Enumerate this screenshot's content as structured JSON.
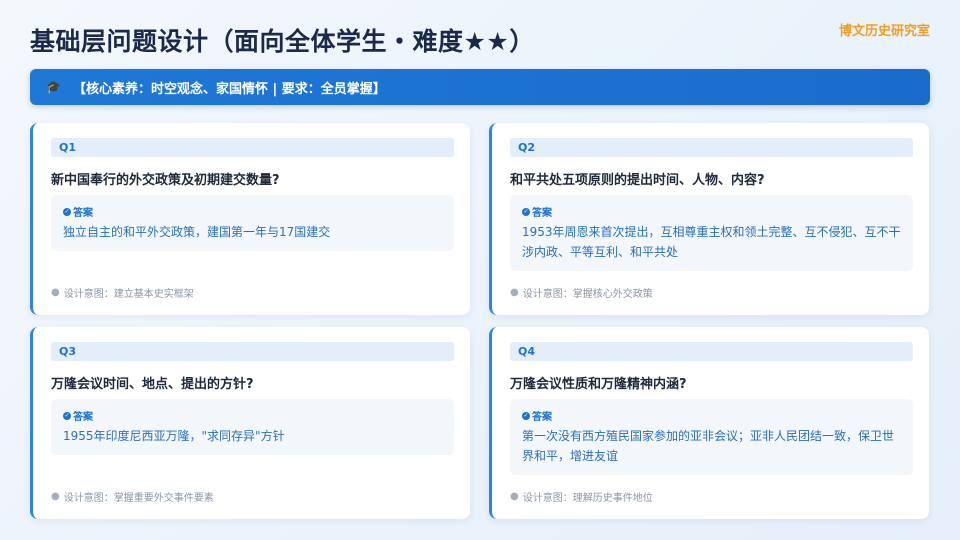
{
  "title": "基础层问题设计（面向全体学生・难度★★）",
  "brand": "博文历史研究室",
  "banner": {
    "icon": "graduation-cap-icon",
    "text": "【核心素养：时空观念、家国情怀 | 要求：全员掌握】"
  },
  "cards": [
    {
      "tag": "Q1",
      "question": "新中国奉行的外交政策及初期建交数量?",
      "answer_label": "答案",
      "answer": "独立自主的和平外交政策，建国第一年与17国建交",
      "intent": "设计意图：建立基本史实框架"
    },
    {
      "tag": "Q2",
      "question": "和平共处五项原则的提出时间、人物、内容?",
      "answer_label": "答案",
      "answer": "1953年周恩来首次提出，互相尊重主权和领土完整、互不侵犯、互不干涉内政、平等互利、和平共处",
      "intent": "设计意图：掌握核心外交政策"
    },
    {
      "tag": "Q3",
      "question": "万隆会议时间、地点、提出的方针?",
      "answer_label": "答案",
      "answer": "1955年印度尼西亚万隆，\"求同存异\"方针",
      "intent": "设计意图：掌握重要外交事件要素"
    },
    {
      "tag": "Q4",
      "question": "万隆会议性质和万隆精神内涵?",
      "answer_label": "答案",
      "answer": "第一次没有西方殖民国家参加的亚非会议；亚非人民团结一致，保卫世界和平，增进友谊",
      "intent": "设计意图：理解历史事件地位"
    }
  ]
}
